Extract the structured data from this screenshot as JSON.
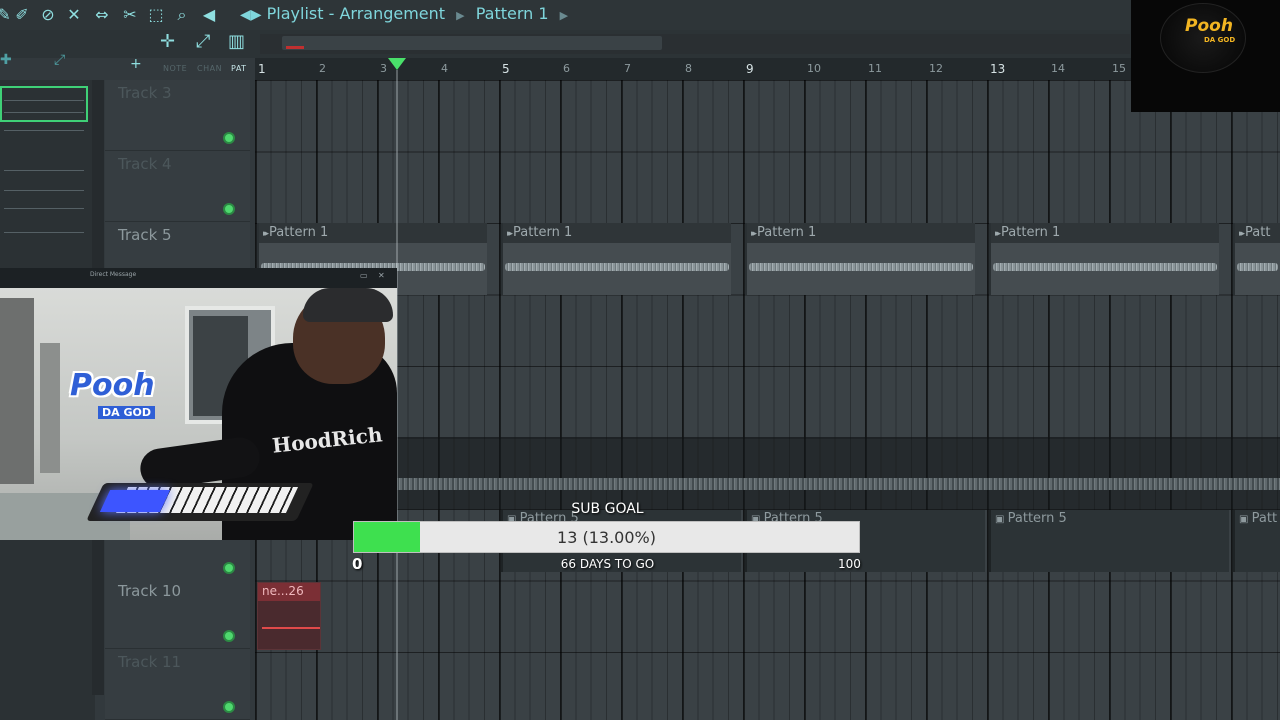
{
  "window": {
    "title": "Playlist - Arrangement",
    "pattern_selector": "Pattern 1"
  },
  "toolbar_icons": [
    "pencil-icon",
    "brush-icon",
    "delete-icon",
    "mute-icon",
    "slip-icon",
    "slice-icon",
    "select-icon",
    "zoom-icon",
    "playback-icon"
  ],
  "modes": {
    "note": "NOTE",
    "chan": "CHAN",
    "pat": "PAT"
  },
  "ruler": {
    "bars": [
      "1",
      "2",
      "3",
      "4",
      "5",
      "6",
      "7",
      "8",
      "9",
      "10",
      "11",
      "12",
      "13",
      "14",
      "15"
    ]
  },
  "tracks": {
    "track3": "Track 3",
    "track4": "Track 4",
    "track5": "Track 5",
    "track10": "Track 10",
    "track11": "Track 11"
  },
  "clips": {
    "track5": [
      "Pattern 1",
      "Pattern 1",
      "Pattern 1",
      "Pattern 1",
      "Patt"
    ],
    "row9": [
      "Pattern 5",
      "Pattern 5",
      "Pattern 5",
      "Patt"
    ],
    "track10_clip": "ne...26"
  },
  "logo": {
    "name": "Pooh",
    "sub": "DA GOD"
  },
  "webcam": {
    "window_title": "Direct Message",
    "overlay_name": "Pooh",
    "overlay_sub": "DA GOD",
    "shirt_text": "HoodRich"
  },
  "sub_goal": {
    "title": "SUB GOAL",
    "current": 13,
    "max": 100,
    "progress": 0.13,
    "label": "13 (13.00%)",
    "min_label": "0",
    "max_label": "100",
    "days_label": "66 DAYS TO GO"
  },
  "colors": {
    "accent": "#7fd6dc",
    "goal_fill": "#3ee04f",
    "playhead": "#49e06a"
  }
}
